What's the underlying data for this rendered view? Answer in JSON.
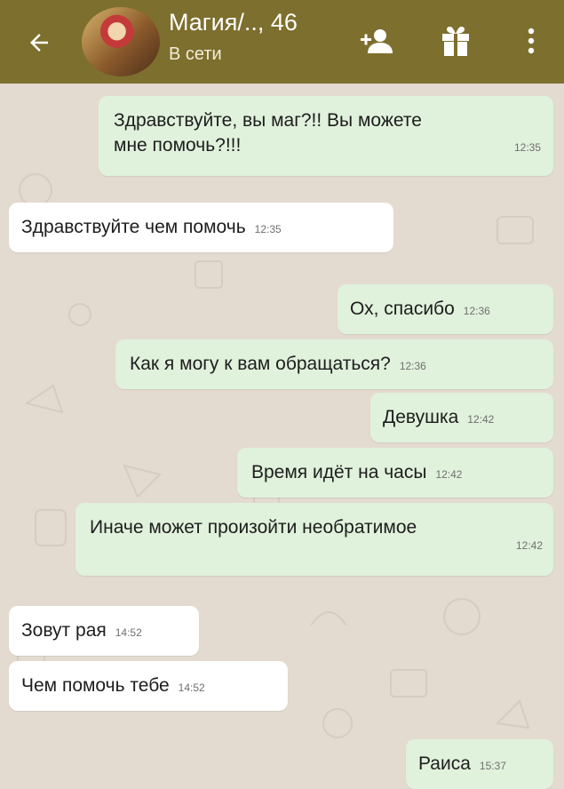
{
  "header": {
    "back_icon": "arrow-left-icon",
    "contact_name": "Магия/.., 46",
    "status": "В сети",
    "add_user_icon": "add-person-icon",
    "gift_icon": "gift-icon",
    "more_icon": "more-vert-icon",
    "bar_color": "#7d6f2d"
  },
  "messages": [
    {
      "dir": "out",
      "lines": [
        "Здравствуйте, вы маг?!! Вы можете",
        "мне помочь?!!!"
      ],
      "time": "12:35"
    },
    {
      "dir": "in",
      "text": "Здравствуйте чем помочь",
      "time": "12:35"
    },
    {
      "dir": "out",
      "text": "Ох, спасибо",
      "time": "12:36"
    },
    {
      "dir": "out",
      "text": "Как я могу к вам обращаться?",
      "time": "12:36"
    },
    {
      "dir": "out",
      "text": "Девушка",
      "time": "12:42"
    },
    {
      "dir": "out",
      "text": "Время идёт на часы",
      "time": "12:42"
    },
    {
      "dir": "out",
      "text": "Иначе может произойти необратимое",
      "time": "12:42"
    },
    {
      "dir": "in",
      "text": "Зовут рая",
      "time": "14:52"
    },
    {
      "dir": "in",
      "text": "Чем помочь тебе",
      "time": "14:52"
    },
    {
      "dir": "out",
      "text": "Раиса",
      "time": "15:37"
    }
  ],
  "colors": {
    "outgoing": "#e0f1dc",
    "incoming": "#ffffff",
    "wallpaper": "#e3dbd0"
  }
}
